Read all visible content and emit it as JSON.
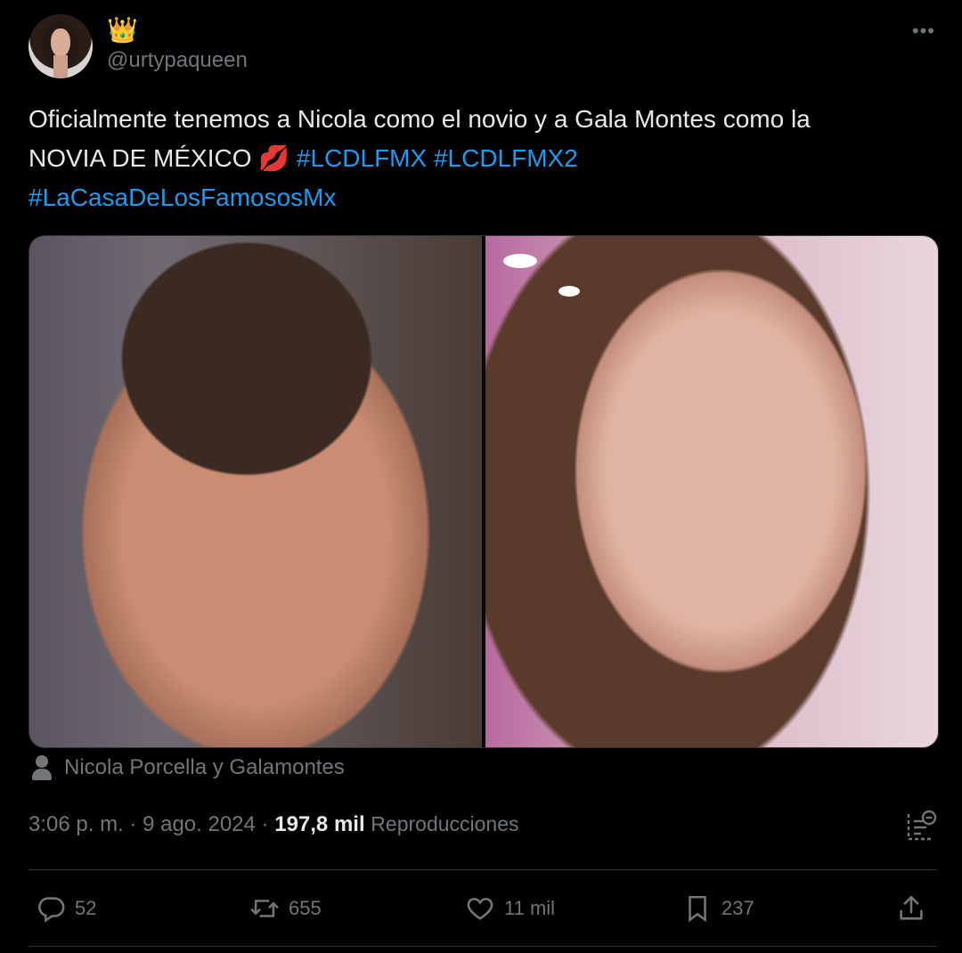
{
  "user": {
    "display_name_emoji": "👑",
    "handle": "@urtypaqueen"
  },
  "tweet": {
    "text_line1": "Oficialmente tenemos a Nicola como el novio y a Gala Montes como la",
    "text_line2": "NOVIA DE MÉXICO 💋 ",
    "hashtags": [
      "#LCDLFMX",
      "#LCDLFMX2",
      "#LaCasaDeLosFamososMx"
    ]
  },
  "media": {
    "tagged_people": "Nicola Porcella y Galamontes"
  },
  "meta": {
    "time": "3:06 p. m.",
    "separator": "·",
    "date": "9 ago. 2024",
    "views_count": "197,8 mil",
    "views_label": "Reproducciones"
  },
  "actions": {
    "replies": "52",
    "reposts": "655",
    "likes": "11 mil",
    "bookmarks": "237"
  },
  "colors": {
    "background": "#000000",
    "text": "#e7e9ea",
    "muted": "#71767b",
    "link": "#1d9bf0",
    "divider": "#2f3336"
  }
}
